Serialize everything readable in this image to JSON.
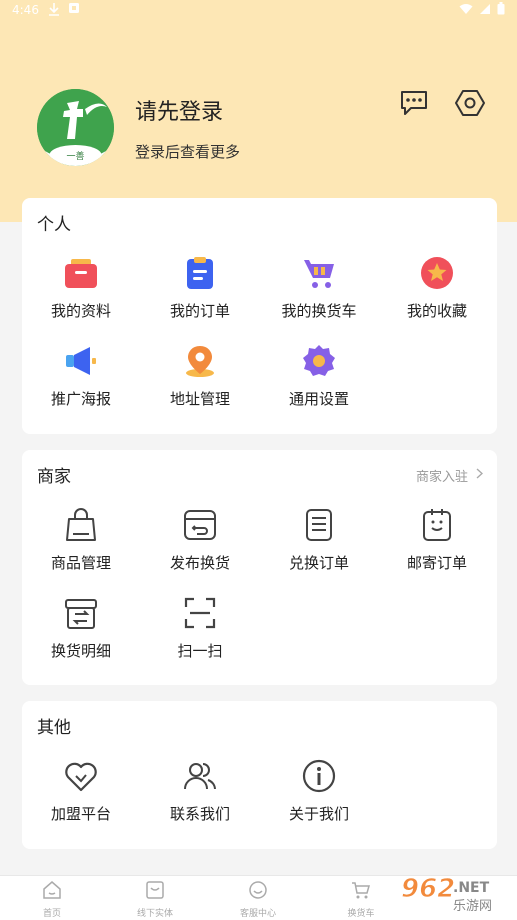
{
  "status_bar": {
    "time": "4:46"
  },
  "profile": {
    "title": "请先登录",
    "subtitle": "登录后查看更多",
    "avatar_text": "一善",
    "avatar_color": "#3fa34d"
  },
  "header_icons": [
    "message-icon",
    "settings-icon"
  ],
  "personal": {
    "title": "个人",
    "items": [
      {
        "label": "我的资料",
        "icon": "profile-card-icon"
      },
      {
        "label": "我的订单",
        "icon": "order-list-icon"
      },
      {
        "label": "我的换货车",
        "icon": "cart-icon"
      },
      {
        "label": "我的收藏",
        "icon": "star-icon"
      },
      {
        "label": "推广海报",
        "icon": "megaphone-icon"
      },
      {
        "label": "地址管理",
        "icon": "location-pin-icon"
      },
      {
        "label": "通用设置",
        "icon": "gear-icon"
      }
    ]
  },
  "merchant": {
    "title": "商家",
    "link": "商家入驻",
    "items": [
      {
        "label": "商品管理",
        "icon": "shopping-bag-icon"
      },
      {
        "label": "发布换货",
        "icon": "exchange-box-icon"
      },
      {
        "label": "兑换订单",
        "icon": "document-icon"
      },
      {
        "label": "邮寄订单",
        "icon": "mail-order-icon"
      },
      {
        "label": "换货明细",
        "icon": "swap-detail-icon"
      },
      {
        "label": "扫一扫",
        "icon": "scan-icon"
      }
    ]
  },
  "other": {
    "title": "其他",
    "items": [
      {
        "label": "加盟平台",
        "icon": "handshake-heart-icon"
      },
      {
        "label": "联系我们",
        "icon": "contacts-icon"
      },
      {
        "label": "关于我们",
        "icon": "info-icon"
      }
    ]
  },
  "tabbar": [
    {
      "label": "首页",
      "icon": "home-icon"
    },
    {
      "label": "线下实体",
      "icon": "store-icon"
    },
    {
      "label": "客服中心",
      "icon": "service-icon"
    },
    {
      "label": "换货车",
      "icon": "cart-tab-icon"
    }
  ],
  "watermark": {
    "text1": "962",
    "text2": ".NET",
    "text3": "乐游网"
  },
  "colors": {
    "header_bg": "#fde7b5",
    "accent_red": "#f0505a",
    "accent_blue": "#3d63f0",
    "accent_purple": "#8660e6",
    "accent_orange": "#f28a3c"
  }
}
